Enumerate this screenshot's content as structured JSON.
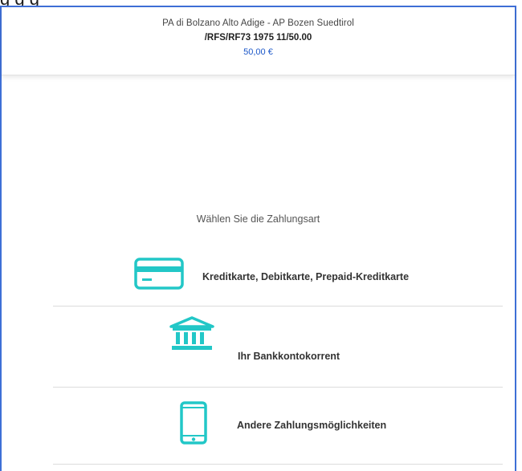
{
  "header": {
    "merchant": "PA di Bolzano Alto Adige - AP Bozen Suedtirol",
    "reference": "/RFS/RF73 1975 11/50.00",
    "amount": "50,00 €"
  },
  "prompt": "Wählen Sie die Zahlungsart",
  "payment_options": [
    {
      "label": "Kreditkarte, Debitkarte, Prepaid-Kreditkarte",
      "icon": "credit-card-icon"
    },
    {
      "label": "Ihr Bankkontokorrent",
      "icon": "bank-icon"
    },
    {
      "label": "Andere Zahlungsmöglichkeiten",
      "icon": "smartphone-icon"
    }
  ],
  "colors": {
    "accent_icon": "#22c7c7",
    "amount": "#1a56c8",
    "frame": "#3e6fd6"
  }
}
